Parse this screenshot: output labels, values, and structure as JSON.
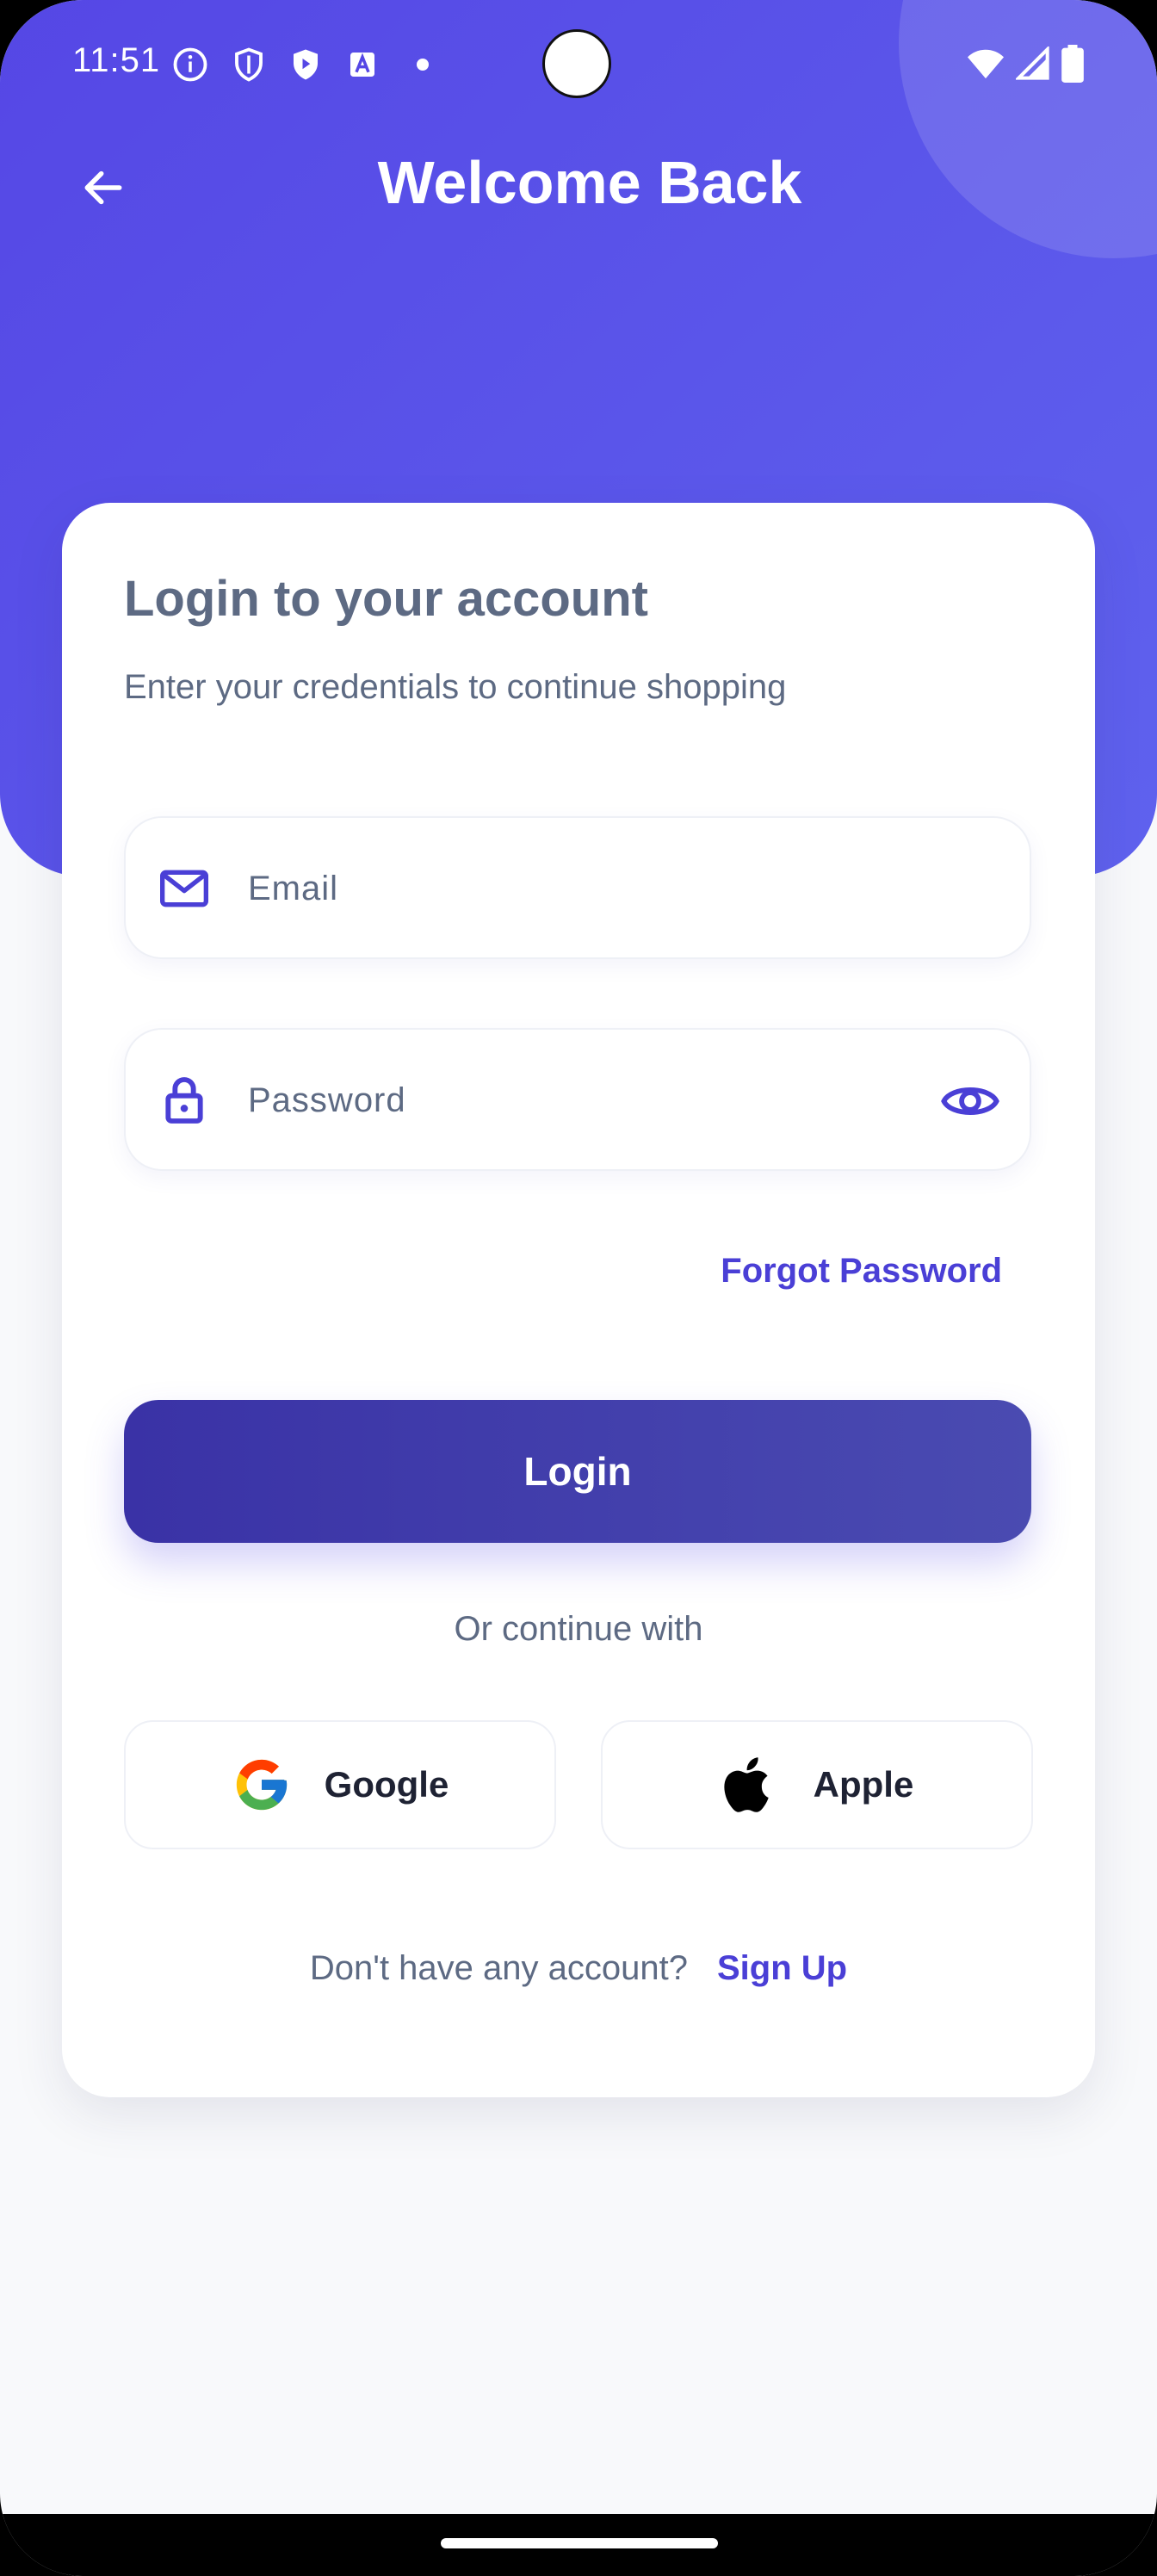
{
  "status_bar": {
    "time": "11:51",
    "left_icons": [
      "info-icon",
      "shield-icon",
      "play-shield-icon",
      "font-icon",
      "dot-icon"
    ],
    "right_icons": [
      "wifi-icon",
      "signal-icon",
      "battery-icon"
    ]
  },
  "header": {
    "title": "Welcome Back",
    "back_icon": "arrow-left-icon"
  },
  "card": {
    "title": "Login to your account",
    "subtitle": "Enter your credentials to continue shopping"
  },
  "form": {
    "email": {
      "placeholder": "Email",
      "value": "",
      "icon": "mail-icon"
    },
    "password": {
      "placeholder": "Password",
      "value": "",
      "icon": "lock-icon",
      "toggle_icon": "eye-icon"
    },
    "forgot_label": "Forgot Password",
    "login_label": "Login"
  },
  "social": {
    "divider_text": "Or continue with",
    "google_label": "Google",
    "apple_label": "Apple"
  },
  "signup": {
    "prompt": "Don't have any account?",
    "link": "Sign Up"
  },
  "colors": {
    "header_gradient_start": "#5547e5",
    "header_gradient_end": "#5f62ee",
    "accent": "#4a3fd6",
    "button_start": "#3a32a6",
    "button_end": "#4a4bb1",
    "text_muted": "#5d6a83",
    "background": "#f8f9fb"
  }
}
